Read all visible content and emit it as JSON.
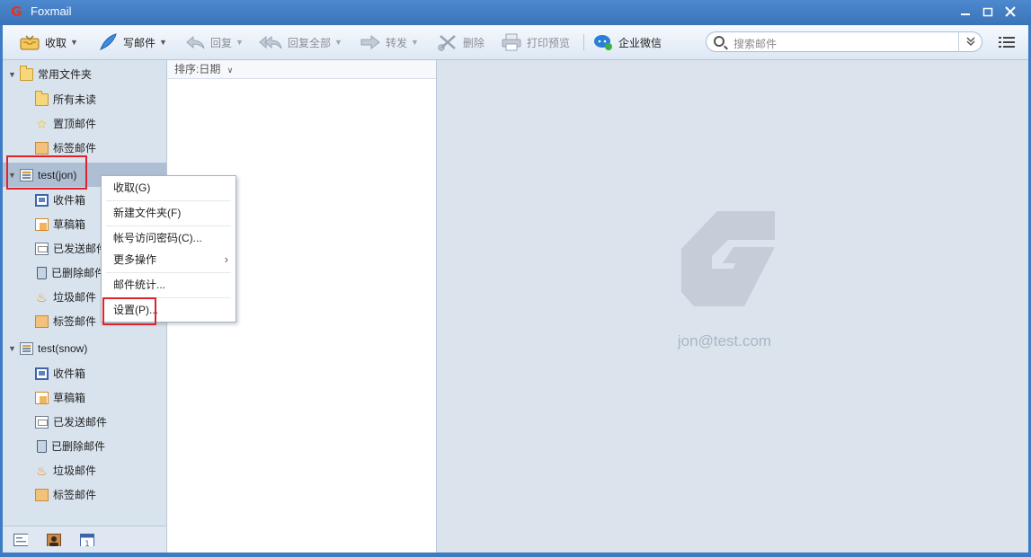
{
  "window": {
    "title": "Foxmail",
    "logo": "G"
  },
  "toolbar": {
    "receive": "收取",
    "compose": "写邮件",
    "reply": "回复",
    "reply_all": "回复全部",
    "forward": "转发",
    "delete": "删除",
    "print_preview": "打印预览",
    "wecom": "企业微信",
    "search_placeholder": "搜索邮件",
    "search_dropdown": "≫"
  },
  "sidebar": {
    "common": {
      "label": "常用文件夹",
      "items": [
        {
          "label": "所有未读",
          "icon": "folder-icon"
        },
        {
          "label": "置顶邮件",
          "icon": "star-icon"
        },
        {
          "label": "标签邮件",
          "icon": "tag-icon"
        }
      ]
    },
    "accounts": [
      {
        "label": "test(jon)",
        "items": [
          {
            "label": "收件箱",
            "icon": "inbox-icon"
          },
          {
            "label": "草稿箱",
            "icon": "draft-icon"
          },
          {
            "label": "已发送邮件",
            "icon": "sent-icon"
          },
          {
            "label": "已删除邮件",
            "icon": "trash-icon"
          },
          {
            "label": "垃圾邮件",
            "icon": "junk-icon"
          },
          {
            "label": "标签邮件",
            "icon": "tag-icon"
          }
        ]
      },
      {
        "label": "test(snow)",
        "items": [
          {
            "label": "收件箱",
            "icon": "inbox-icon"
          },
          {
            "label": "草稿箱",
            "icon": "draft-icon"
          },
          {
            "label": "已发送邮件",
            "icon": "sent-icon"
          },
          {
            "label": "已删除邮件",
            "icon": "trash-icon"
          },
          {
            "label": "垃圾邮件",
            "icon": "junk-icon"
          },
          {
            "label": "标签邮件",
            "icon": "tag-icon"
          }
        ]
      }
    ]
  },
  "list": {
    "sort_label": "排序:日期"
  },
  "reading": {
    "account_email": "jon@test.com"
  },
  "context_menu": {
    "items": [
      {
        "label": "收取(G)"
      },
      {
        "label": "新建文件夹(F)"
      },
      {
        "label": "帐号访问密码(C)..."
      },
      {
        "label": "更多操作"
      },
      {
        "label": "邮件统计..."
      },
      {
        "label": "设置(P)..."
      }
    ]
  },
  "colors": {
    "accent": "#3a73b8",
    "highlight": "#e0222b",
    "brand": "#e8331c"
  }
}
